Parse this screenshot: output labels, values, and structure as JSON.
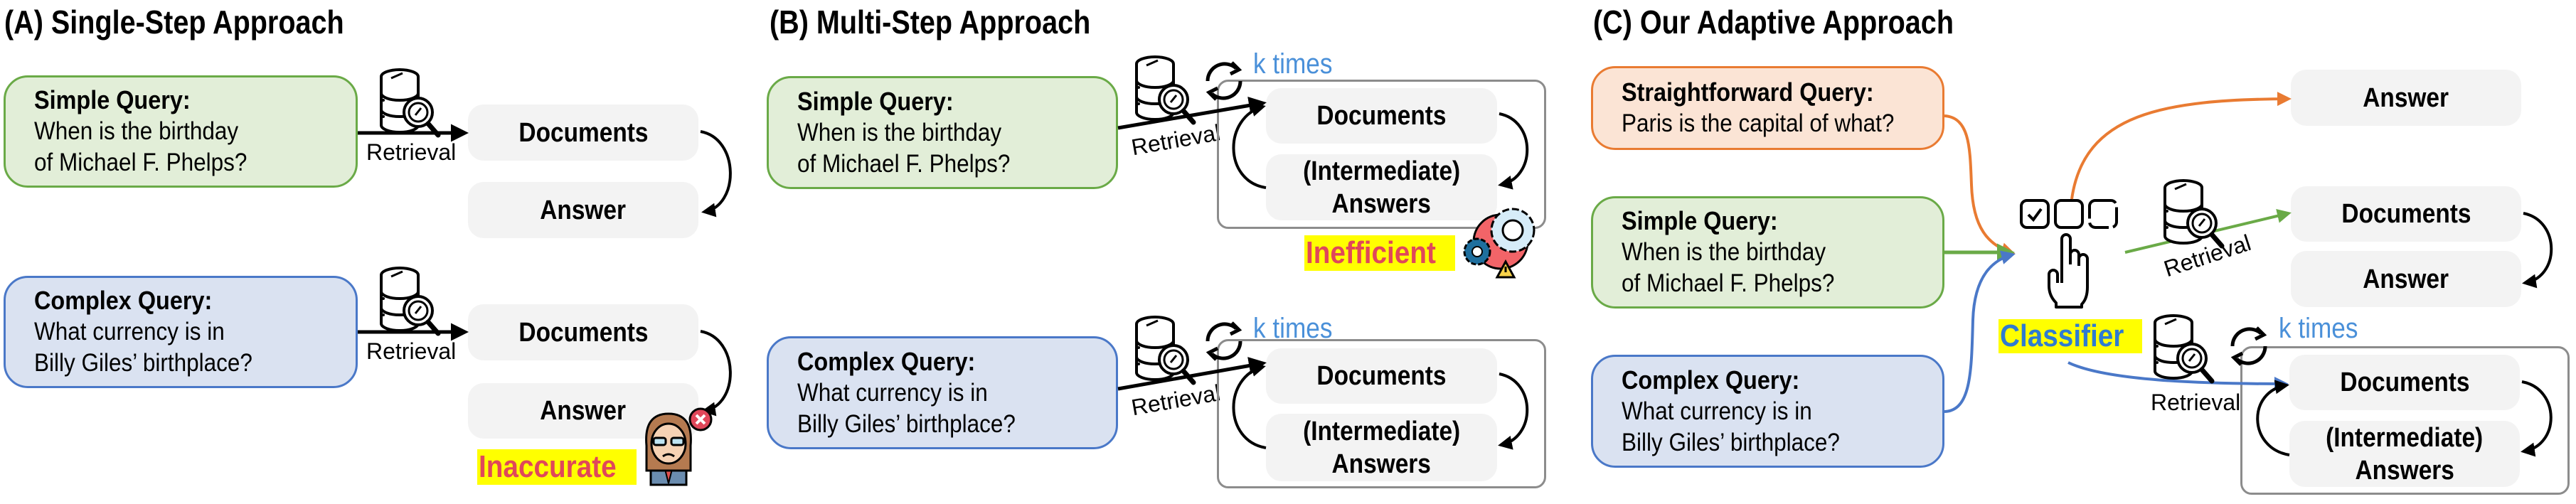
{
  "panels": {
    "a": {
      "title": "(A) Single-Step Approach",
      "rows": [
        {
          "query_type": "Simple Query:",
          "query_line1": "When is the birthday",
          "query_line2": "of Michael F. Phelps?",
          "edge_label": "Retrieval",
          "step1": "Documents",
          "step2": "Answer"
        },
        {
          "query_type": "Complex Query:",
          "query_line1": "What currency is in",
          "query_line2": "Billy Giles’ birthplace?",
          "edge_label": "Retrieval",
          "step1": "Documents",
          "step2": "Answer"
        }
      ],
      "verdict": "Inaccurate"
    },
    "b": {
      "title": "(B) Multi-Step Approach",
      "rows": [
        {
          "query_type": "Simple Query:",
          "query_line1": "When is the birthday",
          "query_line2": "of Michael F. Phelps?",
          "edge_label": "Retrieval",
          "loop_label": "k times",
          "step1": "Documents",
          "step2_line1": "(Intermediate)",
          "step2_line2": "Answers"
        },
        {
          "query_type": "Complex Query:",
          "query_line1": "What currency is in",
          "query_line2": "Billy Giles’ birthplace?",
          "edge_label": "Retrieval",
          "loop_label": "k times",
          "step1": "Documents",
          "step2_line1": "(Intermediate)",
          "step2_line2": "Answers"
        }
      ],
      "verdict": "Inefficient"
    },
    "c": {
      "title": "(C) Our Adaptive Approach",
      "queries": [
        {
          "query_type": "Straightforward Query:",
          "query_line1": "Paris is the capital of what?"
        },
        {
          "query_type": "Simple Query:",
          "query_line1": "When is the birthday",
          "query_line2": "of Michael F. Phelps?"
        },
        {
          "query_type": "Complex Query:",
          "query_line1": "What currency is in",
          "query_line2": "Billy Giles’ birthplace?"
        }
      ],
      "classifier_label": "Classifier",
      "routes": {
        "no_retrieval": {
          "step1": "Answer"
        },
        "single_step": {
          "edge_label": "Retrieval",
          "step1": "Documents",
          "step2": "Answer"
        },
        "multi_step": {
          "edge_label": "Retrieval",
          "loop_label": "k times",
          "step1": "Documents",
          "step2_line1": "(Intermediate)",
          "step2_line2": "Answers"
        }
      }
    }
  },
  "colors": {
    "simple": "#6aaa47",
    "complex": "#4a78c8",
    "straightforward": "#e97b32",
    "highlight": "#ffff00",
    "verdict_text": "#e0475a",
    "classifier_text": "#2f7bd1",
    "loop_text": "#4a90d9"
  },
  "icons": [
    "database-search-icon",
    "refresh-loop-icon",
    "confused-person-icon",
    "gears-warning-icon",
    "checkbox-options-icon",
    "pointing-hand-icon"
  ]
}
